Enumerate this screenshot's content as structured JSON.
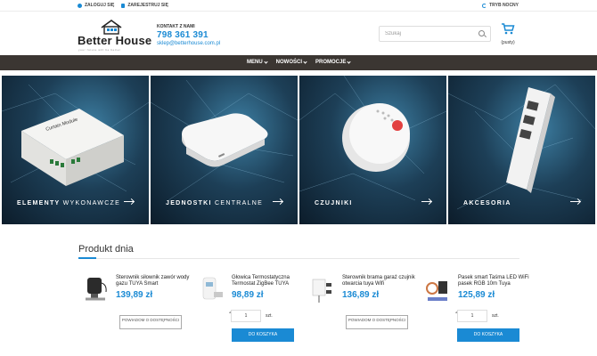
{
  "topbar": {
    "login": "ZALOGUJ SIĘ",
    "register": "ZAREJESTRUJ SIĘ",
    "night_mode": "TRYB NOCNY"
  },
  "brand": {
    "name": "Better House",
    "tagline": "your future will be better",
    "accent": "#1a8ad4"
  },
  "contact": {
    "label": "KONTAKT Z NAMI",
    "phone": "798 361 391",
    "email": "sklep@betterhouse.com.pl"
  },
  "search": {
    "placeholder": "Szukaj"
  },
  "cart": {
    "label": "(pusty)"
  },
  "nav": {
    "items": [
      {
        "label": "MENU"
      },
      {
        "label": "NOWOŚCI"
      },
      {
        "label": "PROMOCJE"
      }
    ]
  },
  "banners": [
    {
      "title": "ELEMENTY",
      "subtitle": "WYKONAWCZE",
      "icon": "relay-module-icon"
    },
    {
      "title": "JEDNOSTKI",
      "subtitle": "CENTRALNE",
      "icon": "hub-icon"
    },
    {
      "title": "CZUJNIKI",
      "subtitle": "",
      "icon": "sensor-icon"
    },
    {
      "title": "AKCESORIA",
      "subtitle": "",
      "icon": "remote-icon"
    }
  ],
  "product_section": {
    "title": "Produkt dnia",
    "products": [
      {
        "name": "Sterownik siłownik zawór wody gazu TUYA Smart",
        "price": "139,89 zł",
        "action": "POWIADOM O DOSTĘPNOŚCI"
      },
      {
        "name": "Głowica Termostatyczna Termostat ZigBee TUYA",
        "price": "98,89 zł",
        "qty": "1",
        "unit": "szt.",
        "action": "DO KOSZYKA"
      },
      {
        "name": "Sterownik brama garaż czujnik otwarcia tuya Wifi",
        "price": "136,89 zł",
        "action": "POWIADOM O DOSTĘPNOŚCI"
      },
      {
        "name": "Pasek smart Taśma LED WiFi pasek RGB 10m Tuya",
        "price": "125,89 zł",
        "qty": "1",
        "unit": "szt.",
        "action": "DO KOSZYKA"
      }
    ]
  },
  "banner_device_label": "Curtain Module"
}
